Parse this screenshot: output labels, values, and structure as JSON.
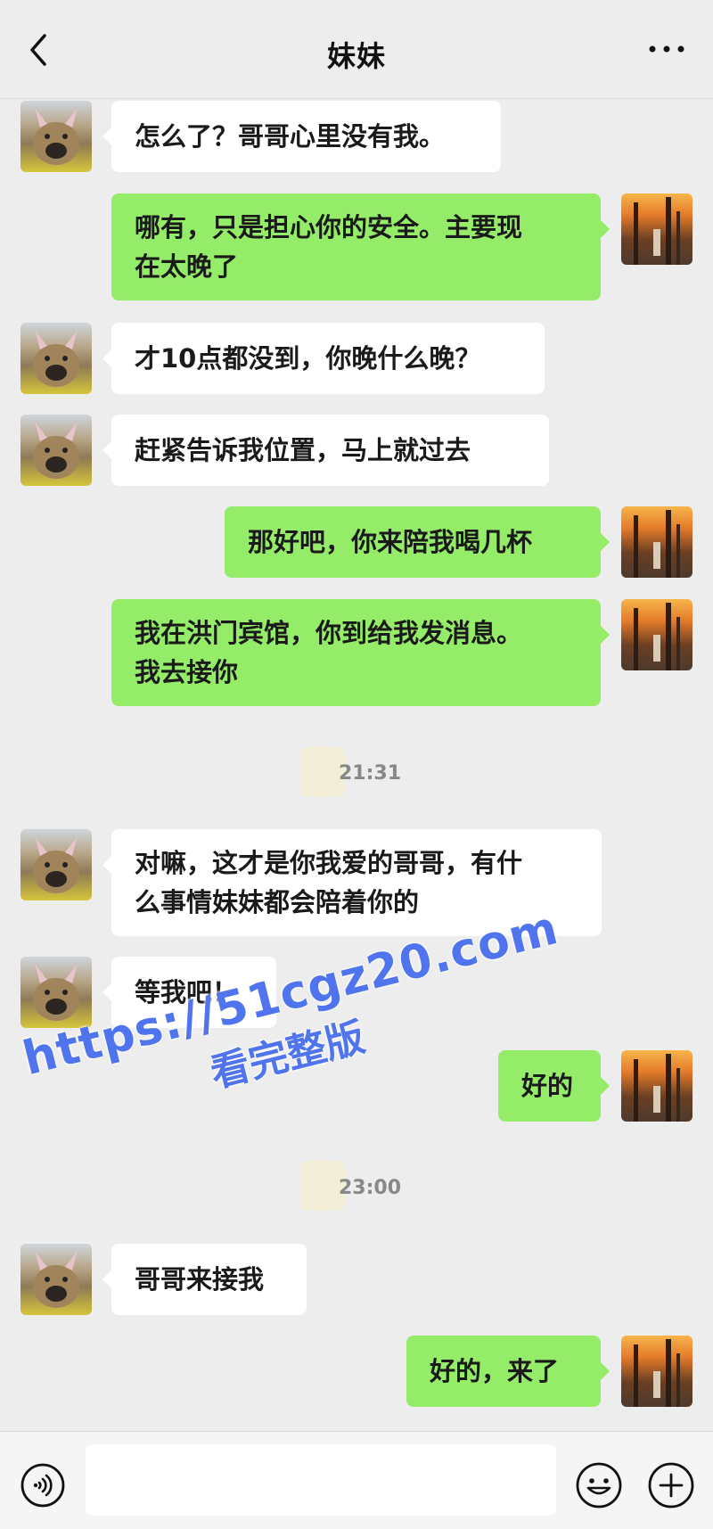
{
  "header": {
    "title": "妹妹",
    "back_icon": "chevron-left-icon",
    "more_icon": "more-dots-icon"
  },
  "messages": [
    {
      "side": "left",
      "lines": [
        "怎么了？哥哥心里没有我。"
      ]
    },
    {
      "side": "right",
      "lines": [
        "哪有，只是担心你的安全。主要现",
        "在太晚了"
      ]
    },
    {
      "side": "left",
      "lines": [
        "才10点都没到，你晚什么晚？"
      ]
    },
    {
      "side": "left",
      "lines": [
        "赶紧告诉我位置，马上就过去"
      ]
    },
    {
      "side": "right",
      "lines": [
        "那好吧，你来陪我喝几杯"
      ]
    },
    {
      "side": "right",
      "lines": [
        "我在洪门宾馆，你到给我发消息。",
        "我去接你"
      ]
    },
    {
      "side": "left",
      "lines": [
        "对嘛，这才是你我爱的哥哥，有什",
        "么事情妹妹都会陪着你的"
      ]
    },
    {
      "side": "left",
      "lines": [
        "等我吧！"
      ]
    },
    {
      "side": "right",
      "lines": [
        "好的"
      ]
    },
    {
      "side": "left",
      "lines": [
        "哥哥来接我"
      ]
    },
    {
      "side": "right",
      "lines": [
        "好的，来了"
      ]
    }
  ],
  "timestamps": [
    "21:31",
    "23:00"
  ],
  "watermark": {
    "url": "https://51cgz20.com",
    "subtitle": "看完整版"
  },
  "input_bar": {
    "voice_icon": "voice-icon",
    "input_value": "",
    "emoji_icon": "emoji-icon",
    "plus_icon": "plus-icon"
  },
  "colors": {
    "background": "#ededed",
    "incoming_bubble": "#ffffff",
    "outgoing_bubble": "#95ec69",
    "watermark": "#4f74ee"
  }
}
